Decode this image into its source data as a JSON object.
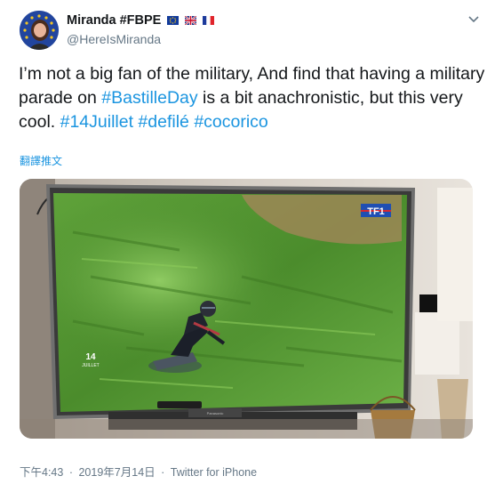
{
  "author": {
    "display_name": "Miranda #FBPE",
    "flags": [
      "eu-flag-icon",
      "uk-flag-icon",
      "fr-flag-icon"
    ],
    "handle": "@HereIsMiranda"
  },
  "tweet": {
    "segments": [
      {
        "text": "I’m not a big fan of the military, And find that having a military parade on ",
        "tag": false
      },
      {
        "text": "#BastilleDay",
        "tag": true
      },
      {
        "text": " is a bit anachronistic, but this very cool. ",
        "tag": false
      },
      {
        "text": "#14Juillet",
        "tag": true
      },
      {
        "text": " ",
        "tag": false
      },
      {
        "text": "#defilé",
        "tag": true
      },
      {
        "text": " ",
        "tag": false
      },
      {
        "text": "#cocorico",
        "tag": true
      }
    ],
    "translate_label": "翻譯推文"
  },
  "media": {
    "tv_logo": "TF1",
    "overlay_date_number": "14",
    "overlay_date_month": "JUILLET",
    "brand": "Panasonic"
  },
  "footer": {
    "time": "下午4:43",
    "date": "2019年7月14日",
    "separator": "·",
    "source": "Twitter for iPhone"
  },
  "colors": {
    "link": "#1b95e0",
    "text": "#14171a",
    "muted": "#657786"
  }
}
